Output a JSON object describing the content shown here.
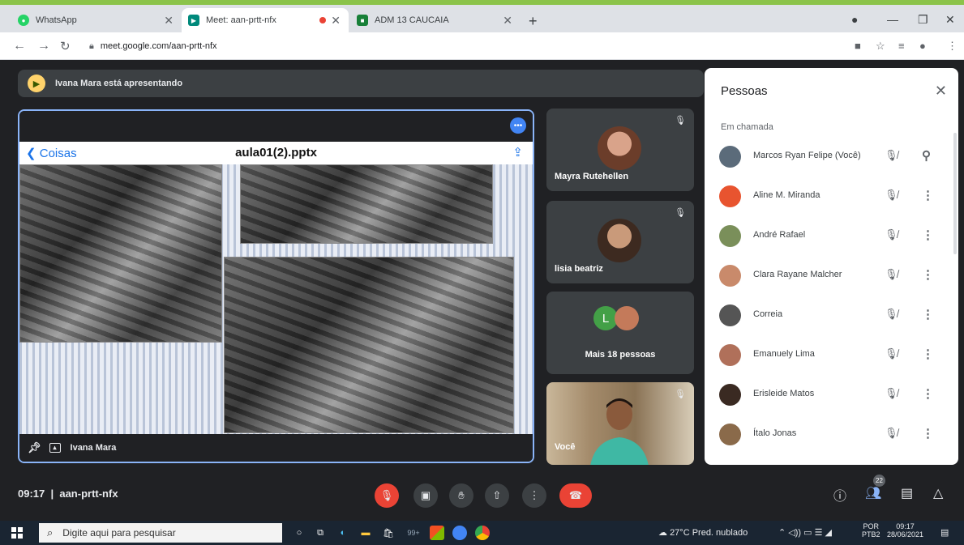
{
  "browser": {
    "tabs": [
      {
        "title": "WhatsApp",
        "active": false
      },
      {
        "title": "Meet: aan-prtt-nfx",
        "active": true
      },
      {
        "title": "ADM 13 CAUCAIA",
        "active": false
      }
    ],
    "url": "meet.google.com/aan-prtt-nfx"
  },
  "meet": {
    "presenting_banner": "Ivana Mara está apresentando",
    "presentation": {
      "back_label": "Coisas",
      "file_title": "aula01(2).pptx",
      "presenter_name": "Ivana Mara"
    },
    "tiles": [
      {
        "name": "Mayra Rutehellen"
      },
      {
        "name": "lisia beatriz"
      },
      {
        "more_label": "Mais 18 pessoas",
        "avatar_letter": "L"
      },
      {
        "name": "Você"
      }
    ],
    "people_panel": {
      "title": "Pessoas",
      "section": "Em chamada",
      "participants": [
        {
          "name": "Marcos Ryan Felipe (Você)",
          "color": "#5b6b7a"
        },
        {
          "name": "Aline M. Miranda",
          "color": "#e8542f"
        },
        {
          "name": "André Rafael",
          "color": "#7a8f5a"
        },
        {
          "name": "Clara Rayane Malcher",
          "color": "#c98a6b"
        },
        {
          "name": "Correia",
          "color": "#555555"
        },
        {
          "name": "Emanuely Lima",
          "color": "#b0705a"
        },
        {
          "name": "Erisleide Matos",
          "color": "#3a2a22"
        },
        {
          "name": "Ítalo Jonas",
          "color": "#8a6a4a"
        }
      ]
    },
    "bottom_bar": {
      "time": "09:17",
      "meeting_code": "aan-prtt-nfx",
      "people_count": "22"
    }
  },
  "taskbar": {
    "search_placeholder": "Digite aqui para pesquisar",
    "weather": "27°C  Pred. nublado",
    "language": "POR",
    "layout": "PTB2",
    "time": "09:17",
    "date": "28/06/2021",
    "badge_count": "99+"
  }
}
